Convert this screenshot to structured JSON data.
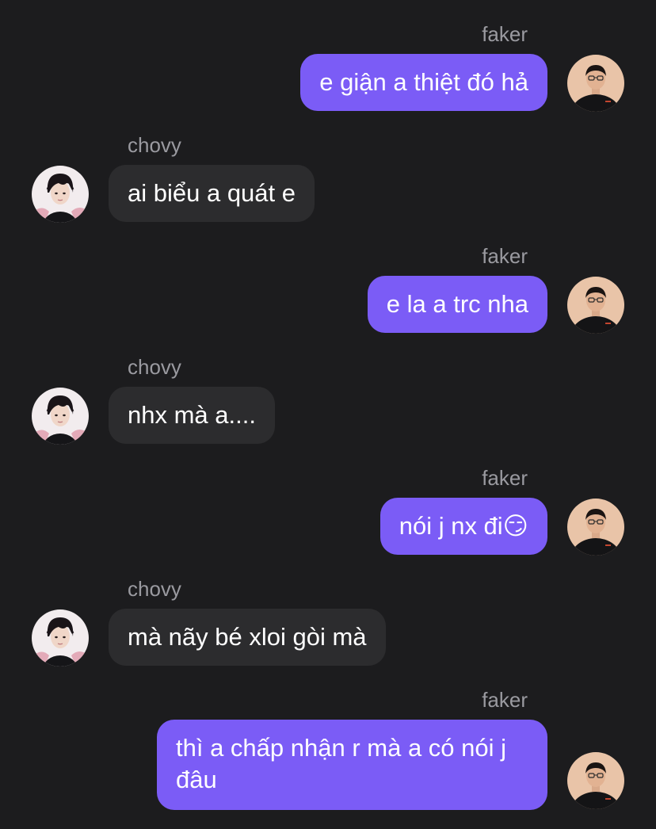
{
  "conversation": {
    "messages": [
      {
        "direction": "out",
        "sender": "faker",
        "text": "e giận a thiệt đó hả"
      },
      {
        "direction": "in",
        "sender": "chovy",
        "text": "ai biểu a quát e"
      },
      {
        "direction": "out",
        "sender": "faker",
        "text": "e la a trc nha"
      },
      {
        "direction": "in",
        "sender": "chovy",
        "text": "nhx mà a...."
      },
      {
        "direction": "out",
        "sender": "faker",
        "text": "nói j nx đi😏"
      },
      {
        "direction": "in",
        "sender": "chovy",
        "text": "mà nãy bé xloi gòi mà"
      },
      {
        "direction": "out",
        "sender": "faker",
        "text": "thì a chấp nhận r mà a có nói j đâu"
      }
    ]
  },
  "colors": {
    "background": "#1c1c1e",
    "outgoing_bubble": "#7b5cf6",
    "incoming_bubble": "#2c2c2e",
    "sender_name": "#9a9aa0"
  },
  "icons": {
    "faker_avatar": "faker-avatar",
    "chovy_avatar": "chovy-avatar"
  }
}
